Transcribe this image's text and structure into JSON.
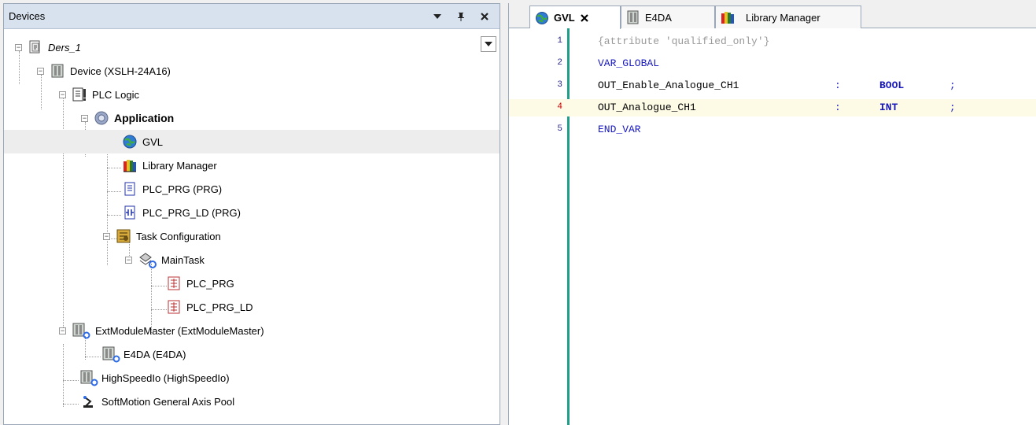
{
  "devices_panel": {
    "title": "Devices",
    "pin_glyph": " ’",
    "tree": {
      "root": "Ders_1",
      "device": "Device (XSLH-24A16)",
      "plc_logic": "PLC Logic",
      "application": "Application",
      "gvl": "GVL",
      "library_manager": "Library Manager",
      "plc_prg": "PLC_PRG (PRG)",
      "plc_prg_ld": "PLC_PRG_LD (PRG)",
      "task_configuration": "Task Configuration",
      "main_task": "MainTask",
      "task_plc_prg": "PLC_PRG",
      "task_plc_prg_ld": "PLC_PRG_LD",
      "ext_module_master": "ExtModuleMaster (ExtModuleMaster)",
      "e4da": "E4DA (E4DA)",
      "high_speed_io": "HighSpeedIo (HighSpeedIo)",
      "softmotion": "SoftMotion General Axis Pool"
    }
  },
  "editor": {
    "tabs": [
      {
        "label": "GVL",
        "active": true
      },
      {
        "label": "E4DA",
        "active": false
      },
      {
        "label": "Library Manager",
        "active": false
      }
    ],
    "line_numbers": [
      "1",
      "2",
      "3",
      "4",
      "5"
    ],
    "lines": {
      "l1": "{attribute 'qualified_only'}",
      "l2": "VAR_GLOBAL",
      "l3_name": "OUT_Enable_Analogue_CH1",
      "l3_colon": ":",
      "l3_type": "BOOL",
      "l3_semi": ";",
      "l4_name": "OUT_Analogue_CH1",
      "l4_colon": ":",
      "l4_type": "INT",
      "l4_semi": ";",
      "l5": "END_VAR"
    }
  },
  "colors": {
    "keyword": "#1818c0",
    "comment": "#999999",
    "gutter_bar": "#1f9e8a",
    "current_line": "#fdfae6"
  }
}
